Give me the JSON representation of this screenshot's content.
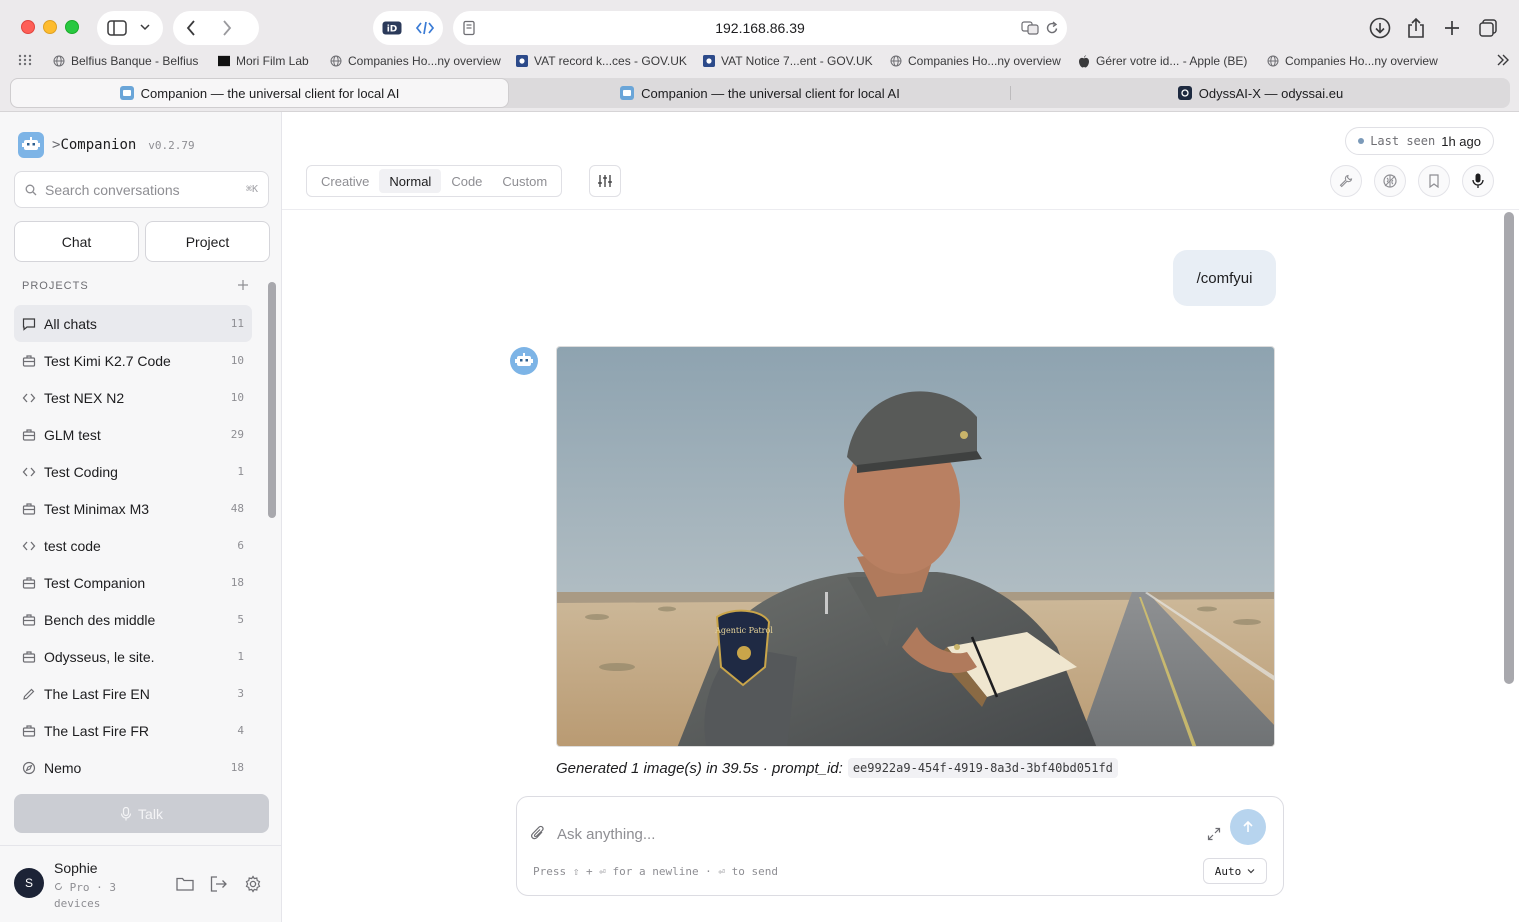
{
  "browser": {
    "url": "192.168.86.39",
    "bookmarks": [
      {
        "label": "Belfius Banque - Belfius",
        "icon": "globe-icon"
      },
      {
        "label": "Mori Film Lab",
        "icon": "mori-logo-icon"
      },
      {
        "label": "Companies Ho...ny overview",
        "icon": "globe-icon"
      },
      {
        "label": "VAT record k...ces - GOV.UK",
        "icon": "gov-uk-icon"
      },
      {
        "label": "VAT Notice 7...ent - GOV.UK",
        "icon": "gov-uk-icon"
      },
      {
        "label": "Companies Ho...ny overview",
        "icon": "globe-icon"
      },
      {
        "label": "Gérer votre id... - Apple (BE)",
        "icon": "apple-icon"
      },
      {
        "label": "Companies Ho...ny overview",
        "icon": "globe-icon"
      }
    ],
    "tabs": [
      {
        "label": "Companion — the universal client for local AI",
        "active": true
      },
      {
        "label": "Companion — the universal client for local AI",
        "active": false
      },
      {
        "label": "OdyssAI-X — odyssai.eu",
        "active": false
      }
    ]
  },
  "sidebar": {
    "brand_prefix": ">",
    "brand_name": "Companion",
    "version": "v0.2.79",
    "search_placeholder": "Search conversations",
    "search_shortcut": "⌘K",
    "chat_button": "Chat",
    "project_button": "Project",
    "projects_heading": "PROJECTS",
    "projects": [
      {
        "label": "All chats",
        "count": "11",
        "icon": "chat-bubble-icon",
        "active": true
      },
      {
        "label": "Test Kimi K2.7 Code",
        "count": "10",
        "icon": "briefcase-icon"
      },
      {
        "label": "Test NEX N2",
        "count": "10",
        "icon": "code-icon"
      },
      {
        "label": "GLM test",
        "count": "29",
        "icon": "briefcase-icon"
      },
      {
        "label": "Test Coding",
        "count": "1",
        "icon": "code-icon"
      },
      {
        "label": "Test Minimax M3",
        "count": "48",
        "icon": "briefcase-icon"
      },
      {
        "label": "test code",
        "count": "6",
        "icon": "code-icon"
      },
      {
        "label": "Test Companion",
        "count": "18",
        "icon": "briefcase-icon"
      },
      {
        "label": "Bench des middle",
        "count": "5",
        "icon": "briefcase-icon"
      },
      {
        "label": "Odysseus, le site.",
        "count": "1",
        "icon": "briefcase-icon"
      },
      {
        "label": "The Last Fire EN",
        "count": "3",
        "icon": "pencil-icon"
      },
      {
        "label": "The Last Fire FR",
        "count": "4",
        "icon": "briefcase-icon"
      },
      {
        "label": "Nemo",
        "count": "18",
        "icon": "compass-icon"
      }
    ],
    "talk_button": "Talk",
    "user": {
      "initial": "S",
      "name": "Sophie",
      "plan": "Pro · 3 devices"
    }
  },
  "main": {
    "last_seen_label": "Last seen",
    "last_seen_value": "1h ago",
    "modes": [
      {
        "label": "Creative",
        "active": false
      },
      {
        "label": "Normal",
        "active": true
      },
      {
        "label": "Code",
        "active": false
      },
      {
        "label": "Custom",
        "active": false
      }
    ],
    "user_message": "/comfyui",
    "caption_text": "Generated 1 image(s) in 39.5s · prompt_id:",
    "prompt_id": "ee9922a9-454f-4919-8a3d-3bf40bd051fd",
    "image_patch_text": "Agentic Patrol",
    "composer": {
      "placeholder": "Ask anything...",
      "hint": "Press ⇧ + ⏎ for a newline · ⏎ to send",
      "model_select": "Auto"
    }
  },
  "colors": {
    "accent": "#7db4e6",
    "send_button": "#b7d4ee",
    "active_project_bg": "#e9eaee"
  }
}
